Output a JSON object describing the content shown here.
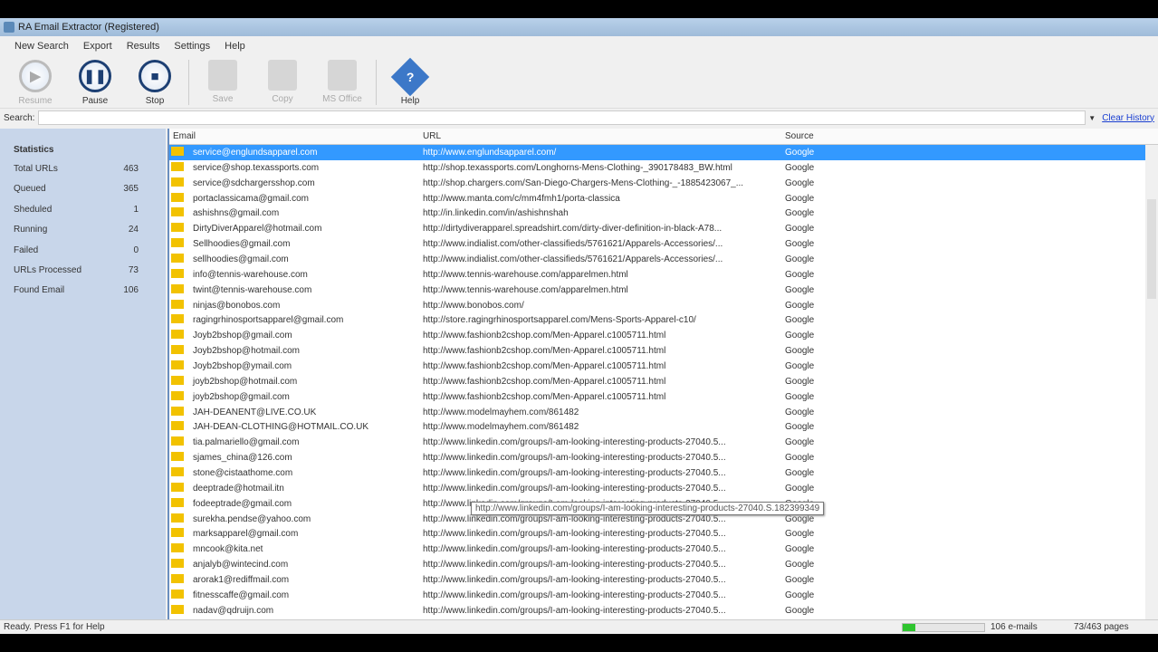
{
  "window": {
    "title": "RA Email Extractor (Registered)"
  },
  "menu": [
    "New Search",
    "Export",
    "Results",
    "Settings",
    "Help"
  ],
  "toolbar": {
    "resume": "Resume",
    "pause": "Pause",
    "stop": "Stop",
    "save": "Save",
    "copy": "Copy",
    "msoffice": "MS Office",
    "help": "Help"
  },
  "search": {
    "label": "Search:",
    "value": "",
    "clear": "Clear History"
  },
  "stats": {
    "title": "Statistics",
    "items": [
      {
        "label": "Total URLs",
        "value": "463"
      },
      {
        "label": "Queued",
        "value": "365"
      },
      {
        "label": "Sheduled",
        "value": "1"
      },
      {
        "label": "Running",
        "value": "24"
      },
      {
        "label": "Failed",
        "value": "0"
      },
      {
        "label": "URLs Processed",
        "value": "73"
      },
      {
        "label": "Found Email",
        "value": "106"
      }
    ]
  },
  "columns": [
    "Email",
    "URL",
    "Source"
  ],
  "rows": [
    [
      "service@englundsapparel.com",
      "http://www.englundsapparel.com/",
      "Google"
    ],
    [
      "service@shop.texassports.com",
      "http://shop.texassports.com/Longhorns-Mens-Clothing-_390178483_BW.html",
      "Google"
    ],
    [
      "service@sdchargersshop.com",
      "http://shop.chargers.com/San-Diego-Chargers-Mens-Clothing-_-1885423067_...",
      "Google"
    ],
    [
      "portaclassicama@gmail.com",
      "http://www.manta.com/c/mm4fmh1/porta-classica",
      "Google"
    ],
    [
      "ashishns@gmail.com",
      "http://in.linkedin.com/in/ashishnshah",
      "Google"
    ],
    [
      "DirtyDiverApparel@hotmail.com",
      "http://dirtydiverapparel.spreadshirt.com/dirty-diver-definition-in-black-A78...",
      "Google"
    ],
    [
      "Sellhoodies@gmail.com",
      "http://www.indialist.com/other-classifieds/5761621/Apparels-Accessories/...",
      "Google"
    ],
    [
      "sellhoodies@gmail.com",
      "http://www.indialist.com/other-classifieds/5761621/Apparels-Accessories/...",
      "Google"
    ],
    [
      "info@tennis-warehouse.com",
      "http://www.tennis-warehouse.com/apparelmen.html",
      "Google"
    ],
    [
      "twint@tennis-warehouse.com",
      "http://www.tennis-warehouse.com/apparelmen.html",
      "Google"
    ],
    [
      "ninjas@bonobos.com",
      "http://www.bonobos.com/",
      "Google"
    ],
    [
      "ragingrhinosportsapparel@gmail.com",
      "http://store.ragingrhinosportsapparel.com/Mens-Sports-Apparel-c10/",
      "Google"
    ],
    [
      "Joyb2bshop@gmail.com",
      "http://www.fashionb2cshop.com/Men-Apparel.c1005711.html",
      "Google"
    ],
    [
      "Joyb2bshop@hotmail.com",
      "http://www.fashionb2cshop.com/Men-Apparel.c1005711.html",
      "Google"
    ],
    [
      "Joyb2bshop@ymail.com",
      "http://www.fashionb2cshop.com/Men-Apparel.c1005711.html",
      "Google"
    ],
    [
      "joyb2bshop@hotmail.com",
      "http://www.fashionb2cshop.com/Men-Apparel.c1005711.html",
      "Google"
    ],
    [
      "joyb2bshop@gmail.com",
      "http://www.fashionb2cshop.com/Men-Apparel.c1005711.html",
      "Google"
    ],
    [
      "JAH-DEANENT@LIVE.CO.UK",
      "http://www.modelmayhem.com/861482",
      "Google"
    ],
    [
      "JAH-DEAN-CLOTHING@HOTMAIL.CO.UK",
      "http://www.modelmayhem.com/861482",
      "Google"
    ],
    [
      "tia.palmariello@gmail.com",
      "http://www.linkedin.com/groups/I-am-looking-interesting-products-27040.5...",
      "Google"
    ],
    [
      "sjames_china@126.com",
      "http://www.linkedin.com/groups/I-am-looking-interesting-products-27040.5...",
      "Google"
    ],
    [
      "stone@cistaathome.com",
      "http://www.linkedin.com/groups/I-am-looking-interesting-products-27040.5...",
      "Google"
    ],
    [
      "deeptrade@hotmail.itn",
      "http://www.linkedin.com/groups/I-am-looking-interesting-products-27040.5...",
      "Google"
    ],
    [
      "fodeeptrade@gmail.com",
      "http://www.linkedin.com/groups/I-am-looking-interesting-products-27040.5...",
      "Google"
    ],
    [
      "surekha.pendse@yahoo.com",
      "http://www.linkedin.com/groups/I-am-looking-interesting-products-27040.5...",
      "Google"
    ],
    [
      "marksapparel@gmail.com",
      "http://www.linkedin.com/groups/I-am-looking-interesting-products-27040.5...",
      "Google"
    ],
    [
      "mncook@kita.net",
      "http://www.linkedin.com/groups/I-am-looking-interesting-products-27040.5...",
      "Google"
    ],
    [
      "anjalyb@wintecind.com",
      "http://www.linkedin.com/groups/I-am-looking-interesting-products-27040.5...",
      "Google"
    ],
    [
      "arorak1@rediffmail.com",
      "http://www.linkedin.com/groups/I-am-looking-interesting-products-27040.5...",
      "Google"
    ],
    [
      "fitnesscaffe@gmail.com",
      "http://www.linkedin.com/groups/I-am-looking-interesting-products-27040.5...",
      "Google"
    ],
    [
      "nadav@qdruijn.com",
      "http://www.linkedin.com/groups/I-am-looking-interesting-products-27040.5...",
      "Google"
    ]
  ],
  "tooltip": "http://www.linkedin.com/groups/I-am-looking-interesting-products-27040.S.182399349",
  "status": {
    "text": "Ready. Press F1 for Help",
    "progress": 0.16,
    "emails": "106 e-mails",
    "pages": "73/463 pages"
  }
}
